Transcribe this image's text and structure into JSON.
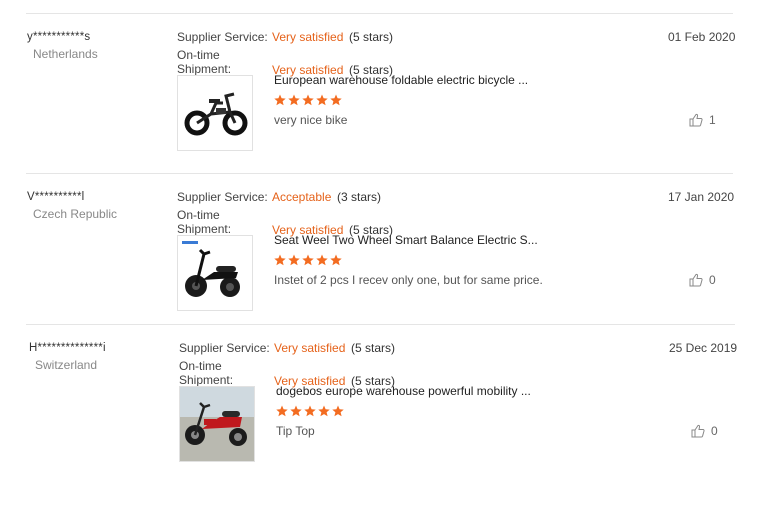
{
  "labels": {
    "supplier_service": "Supplier Service:",
    "on_time": "On-time",
    "shipment": "Shipment:"
  },
  "colors": {
    "accent": "#e5621a",
    "divider": "#e5e5e5"
  },
  "reviews": [
    {
      "user": "y***********s",
      "country": "Netherlands",
      "supplier_rating": "Very satisfied",
      "supplier_stars": "(5 stars)",
      "shipment_rating": "Very satisfied",
      "shipment_stars": "(5 stars)",
      "date": "01 Feb 2020",
      "product_title": "European warehouse foldable electric bicycle ...",
      "product_image": "folding-ebike-icon",
      "stars": 5,
      "comment": "very nice bike",
      "likes": "1"
    },
    {
      "user": "V**********l",
      "country": "Czech Republic",
      "supplier_rating": "Acceptable",
      "supplier_stars": "(3 stars)",
      "shipment_rating": "Very satisfied",
      "shipment_stars": "(5 stars)",
      "date": "17 Jan 2020",
      "product_title": "Seat Weel Two Wheel Smart Balance Electric S...",
      "product_image": "electric-scooter-icon",
      "stars": 5,
      "comment": "Instet of 2 pcs I recev only one, but for same price.",
      "likes": "0"
    },
    {
      "user": "H**************i",
      "country": "Switzerland",
      "supplier_rating": "Very satisfied",
      "supplier_stars": "(5 stars)",
      "shipment_rating": "Very satisfied",
      "shipment_stars": "(5 stars)",
      "date": "25 Dec 2019",
      "product_title": "dogebos europe warehouse powerful mobility ...",
      "product_image": "red-chopper-scooter-icon",
      "stars": 5,
      "comment": "Tip Top",
      "likes": "0"
    }
  ]
}
